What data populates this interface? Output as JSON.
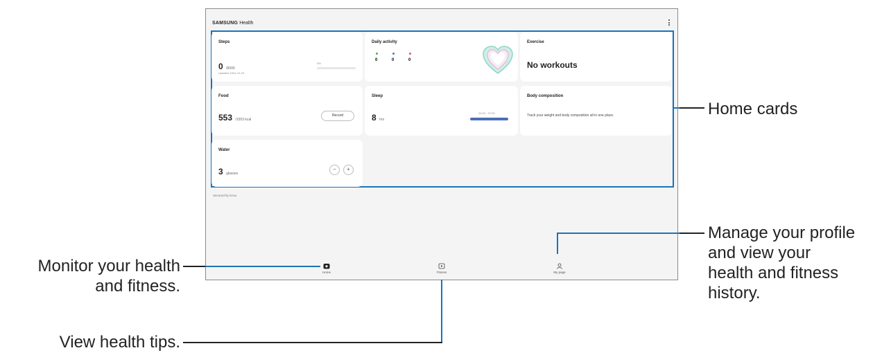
{
  "header": {
    "brand": "SAMSUNG",
    "app": "Health"
  },
  "cards": {
    "steps": {
      "title": "Steps",
      "value": "0",
      "goal": "/6000",
      "updated": "Updated 23/11 21:23",
      "percent": "0%",
      "progress": 0.0
    },
    "daily_activity": {
      "title": "Daily activity",
      "stats": [
        "0",
        "0",
        "0"
      ],
      "stat_colors": [
        "#4caf50",
        "#2f7fd1",
        "#e35757"
      ]
    },
    "exercise": {
      "title": "Exercise",
      "value": "No workouts"
    },
    "food": {
      "title": "Food",
      "value": "553",
      "unit": "/1553 kcal",
      "button": "Record"
    },
    "sleep": {
      "title": "Sleep",
      "value": "8",
      "unit": "hrs",
      "range": "23:00 - 07:00"
    },
    "body": {
      "title": "Body composition",
      "text": "Track your weight and body composition all in one place."
    },
    "water": {
      "title": "Water",
      "value": "3",
      "unit": "glasses"
    }
  },
  "secured": "Secured by Knox",
  "nav": {
    "home": "Home",
    "fitness": "Fitness",
    "mypage": "My page"
  },
  "callouts": {
    "home_cards": "Home cards",
    "profile": [
      "Manage your profile",
      "and view your",
      "health and fitness",
      "history."
    ],
    "monitor": [
      "Monitor your health",
      "and fitness."
    ],
    "tips": "View health tips."
  },
  "colors": {
    "accent": "#1a73b8",
    "sleep_bar": "#4a6fb5"
  }
}
